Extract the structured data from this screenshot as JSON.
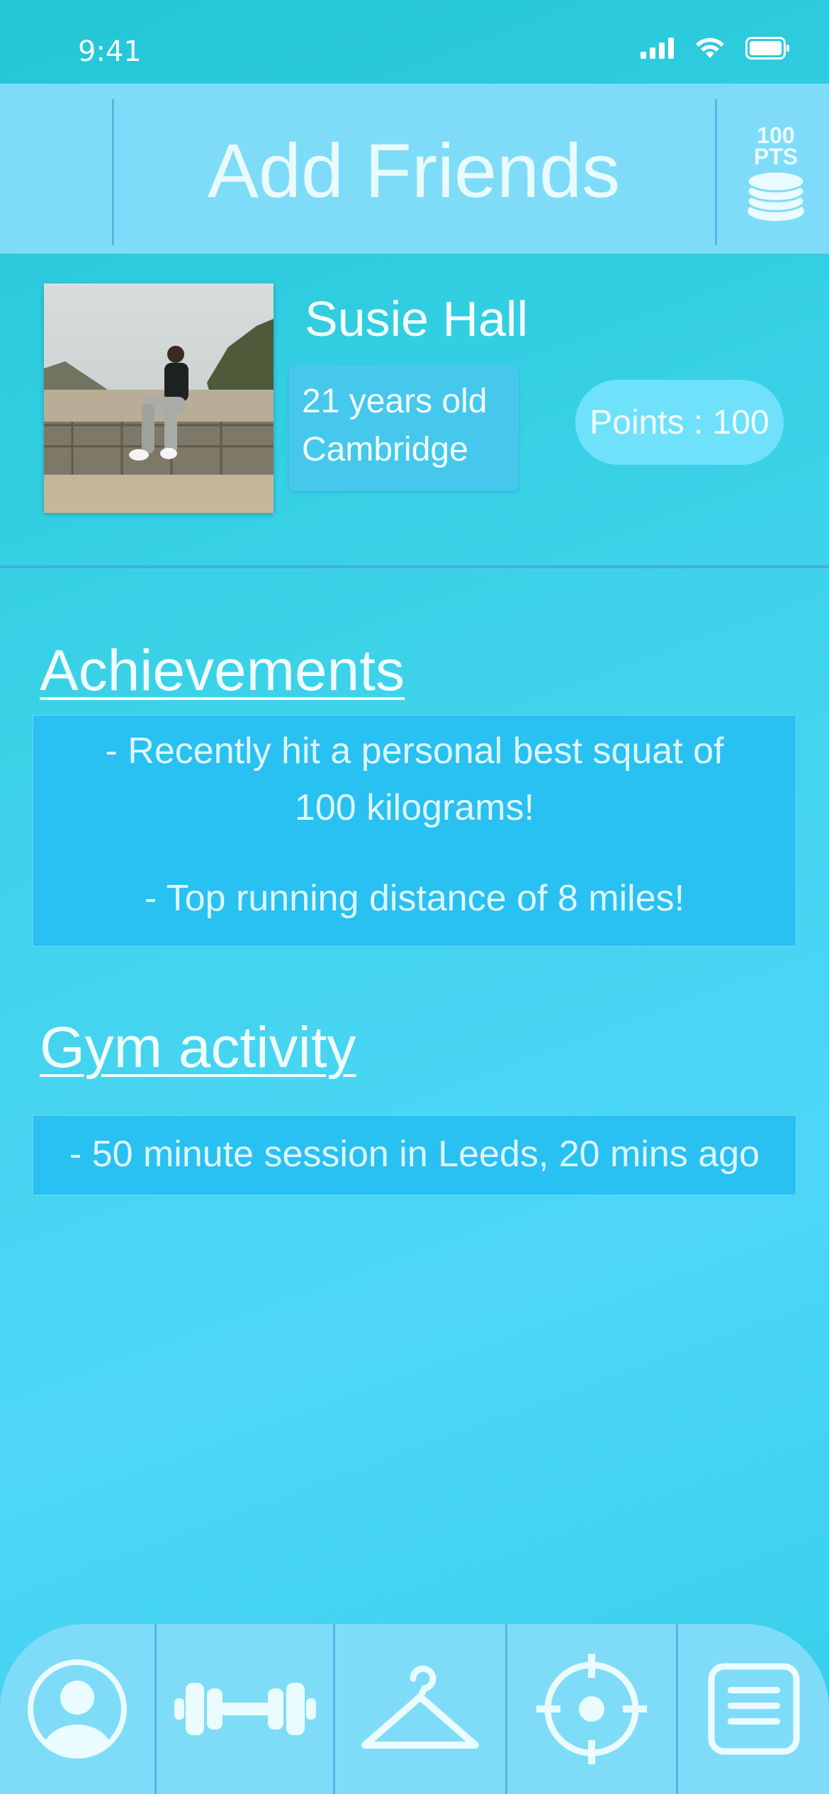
{
  "status_bar": {
    "time": "9:41"
  },
  "header": {
    "title": "Add Friends",
    "points_badge": {
      "amount": "100",
      "unit": "PTS"
    }
  },
  "profile": {
    "name": "Susie Hall",
    "age": "21 years old",
    "location": "Cambridge",
    "points": "Points : 100"
  },
  "achievements": {
    "title": "Achievements",
    "items": [
      "- Recently hit a personal best squat of",
      "100 kilograms!",
      "- Top running distance of 8 miles!"
    ]
  },
  "gym_activity": {
    "title": "Gym activity",
    "items": [
      "- 50 minute session in Leeds, 20 mins ago"
    ]
  },
  "nav": {
    "icons": [
      "profile-icon",
      "dumbbell-icon",
      "hanger-icon",
      "target-icon",
      "list-icon"
    ]
  },
  "colors": {
    "header_bg": "#7fdcf8",
    "box_bg": "#29c0f2",
    "pill_bg": "#6fe1fb"
  }
}
